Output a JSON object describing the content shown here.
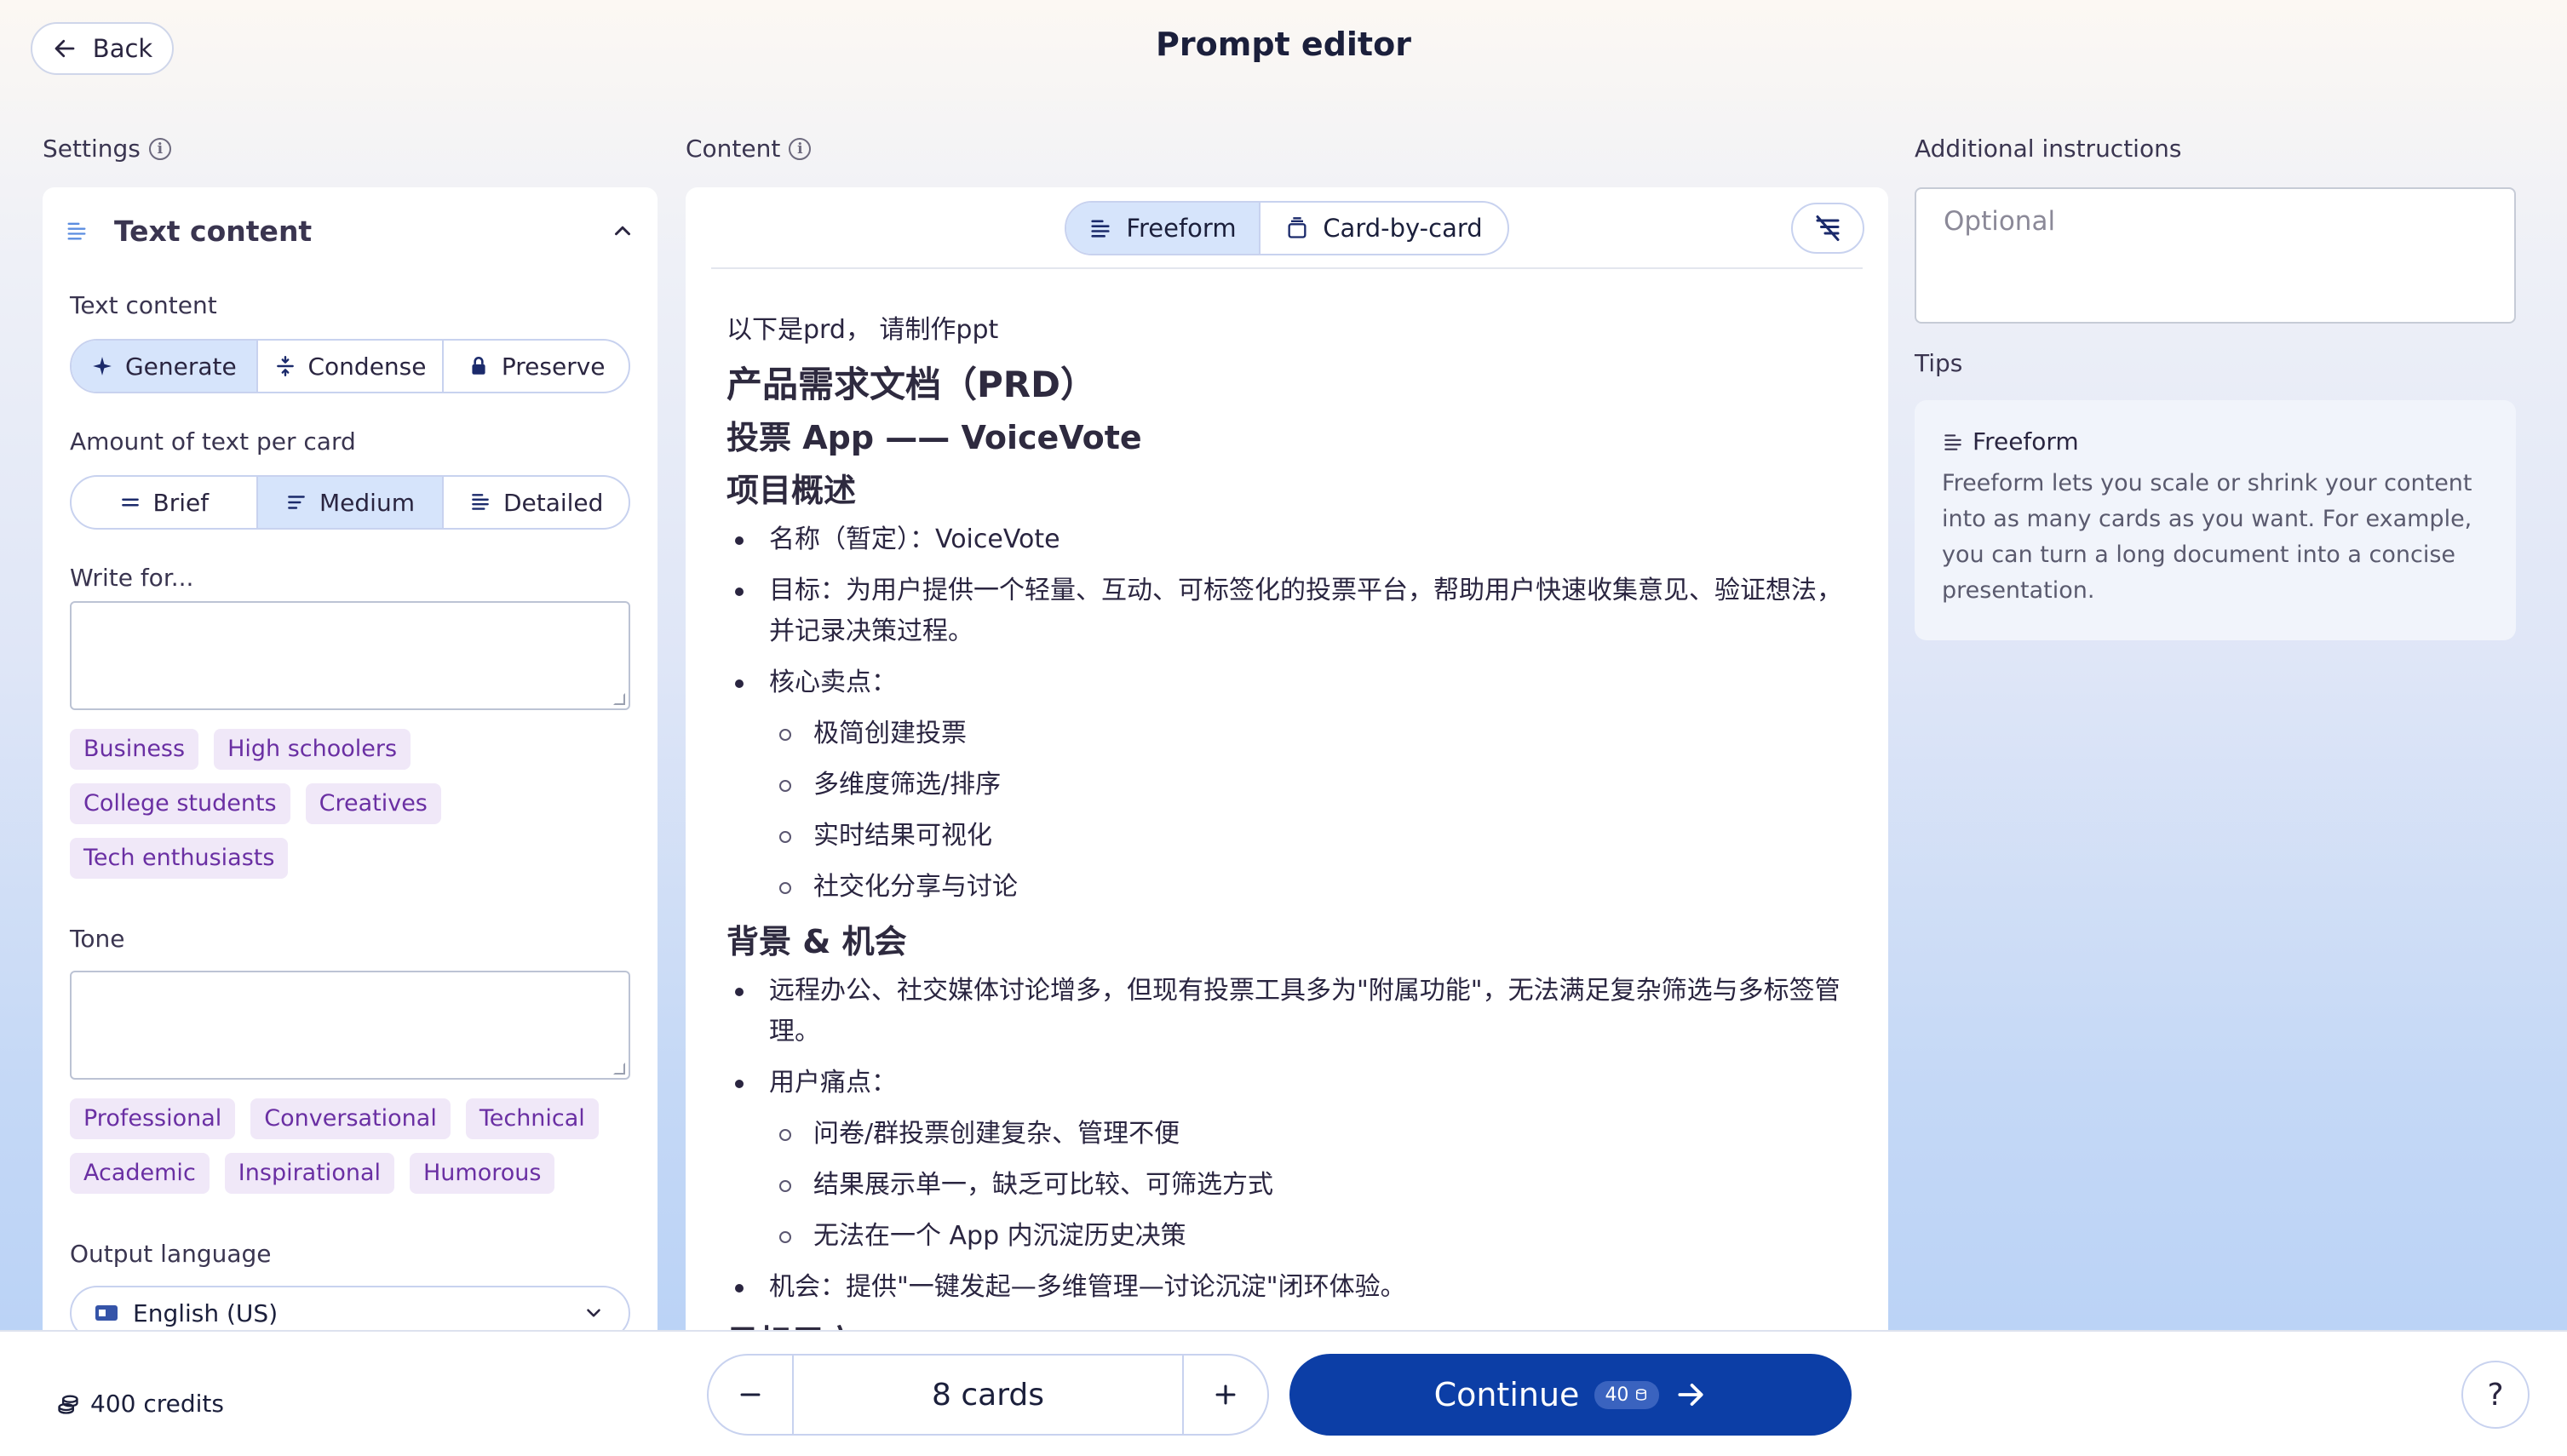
{
  "header": {
    "back_label": "Back",
    "title": "Prompt editor"
  },
  "settings": {
    "section_label": "Settings",
    "panel_title": "Text content",
    "text_content": {
      "label": "Text content",
      "options": [
        "Generate",
        "Condense",
        "Preserve"
      ],
      "selected": "Generate"
    },
    "amount": {
      "label": "Amount of text per card",
      "options": [
        "Brief",
        "Medium",
        "Detailed"
      ],
      "selected": "Medium"
    },
    "write_for": {
      "label": "Write for...",
      "value": "",
      "chips": [
        "Business",
        "High schoolers",
        "College students",
        "Creatives",
        "Tech enthusiasts"
      ]
    },
    "tone": {
      "label": "Tone",
      "value": "",
      "chips": [
        "Professional",
        "Conversational",
        "Technical",
        "Academic",
        "Inspirational",
        "Humorous"
      ]
    },
    "output_language": {
      "label": "Output language",
      "value": "English (US)"
    }
  },
  "content": {
    "section_label": "Content",
    "modes": [
      "Freeform",
      "Card-by-card"
    ],
    "selected_mode": "Freeform",
    "doc": {
      "intro": "以下是prd， 请制作ppt",
      "h1": "产品需求文档（PRD）",
      "h2_app": "投票 App —— VoiceVote",
      "h2_overview": "项目概述",
      "overview": [
        "名称（暂定）：VoiceVote",
        "目标：为用户提供一个轻量、互动、可标签化的投票平台，帮助用户快速收集意见、验证想法，并记录决策过程。",
        "核心卖点："
      ],
      "selling_points": [
        "极简创建投票",
        "多维度筛选/排序",
        "实时结果可视化",
        "社交化分享与讨论"
      ],
      "h2_background": "背景 & 机会",
      "background": [
        "远程办公、社交媒体讨论增多，但现有投票工具多为\"附属功能\"，无法满足复杂筛选与多标签管理。",
        "用户痛点："
      ],
      "pain_points": [
        "问卷/群投票创建复杂、管理不便",
        "结果展示单一，缺乏可比较、可筛选方式",
        "无法在一个 App 内沉淀历史决策"
      ],
      "opportunity": "机会：提供\"一键发起—多维管理—讨论沉淀\"闭环体验。",
      "cutoff": "目标用户"
    }
  },
  "instructions": {
    "label": "Additional instructions",
    "placeholder": "Optional",
    "tips_label": "Tips",
    "tip_title": "Freeform",
    "tip_body": "Freeform lets you scale or shrink your content into as many cards as you want. For example, you can turn a long document into a concise presentation."
  },
  "footer": {
    "credits": "400 credits",
    "card_count": "8 cards",
    "continue_label": "Continue",
    "continue_cost": "40"
  },
  "colors": {
    "primary": "#0c3ea6",
    "chip_bg": "#f0e8f8",
    "chip_text": "#6a2fa3",
    "active_segment": "#d6e4fb"
  }
}
